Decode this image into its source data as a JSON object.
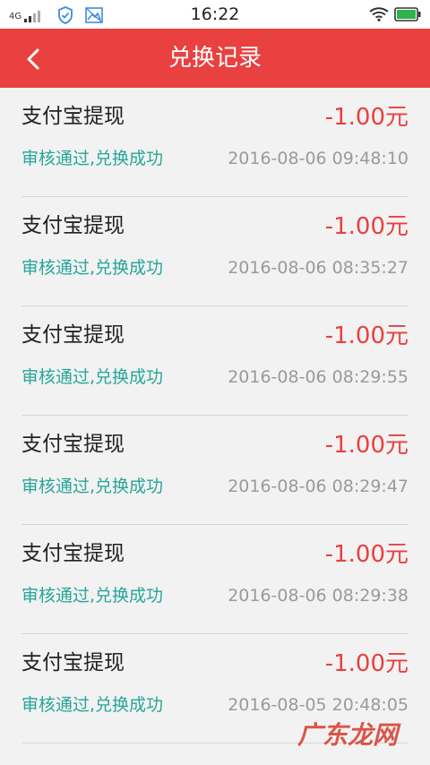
{
  "status_bar": {
    "network": "4G",
    "time": "16:22",
    "icons": [
      "signal-icon",
      "shield-icon",
      "image-icon",
      "wifi-icon",
      "battery-icon"
    ]
  },
  "header": {
    "title": "兑换记录",
    "back_icon": "chevron-left-icon"
  },
  "records": [
    {
      "title": "支付宝提现",
      "amount": "-1.00元",
      "status": "审核通过,兑换成功",
      "time": "2016-08-06 09:48:10"
    },
    {
      "title": "支付宝提现",
      "amount": "-1.00元",
      "status": "审核通过,兑换成功",
      "time": "2016-08-06 08:35:27"
    },
    {
      "title": "支付宝提现",
      "amount": "-1.00元",
      "status": "审核通过,兑换成功",
      "time": "2016-08-06 08:29:55"
    },
    {
      "title": "支付宝提现",
      "amount": "-1.00元",
      "status": "审核通过,兑换成功",
      "time": "2016-08-06 08:29:47"
    },
    {
      "title": "支付宝提现",
      "amount": "-1.00元",
      "status": "审核通过,兑换成功",
      "time": "2016-08-06 08:29:38"
    },
    {
      "title": "支付宝提现",
      "amount": "-1.00元",
      "status": "审核通过,兑换成功",
      "time": "2016-08-05 20:48:05"
    }
  ],
  "watermark": "广东龙网",
  "colors": {
    "header_bg": "#e94040",
    "amount": "#e94040",
    "status": "#26a69a",
    "time": "#9a9a9a",
    "background": "#f2f2f2"
  }
}
